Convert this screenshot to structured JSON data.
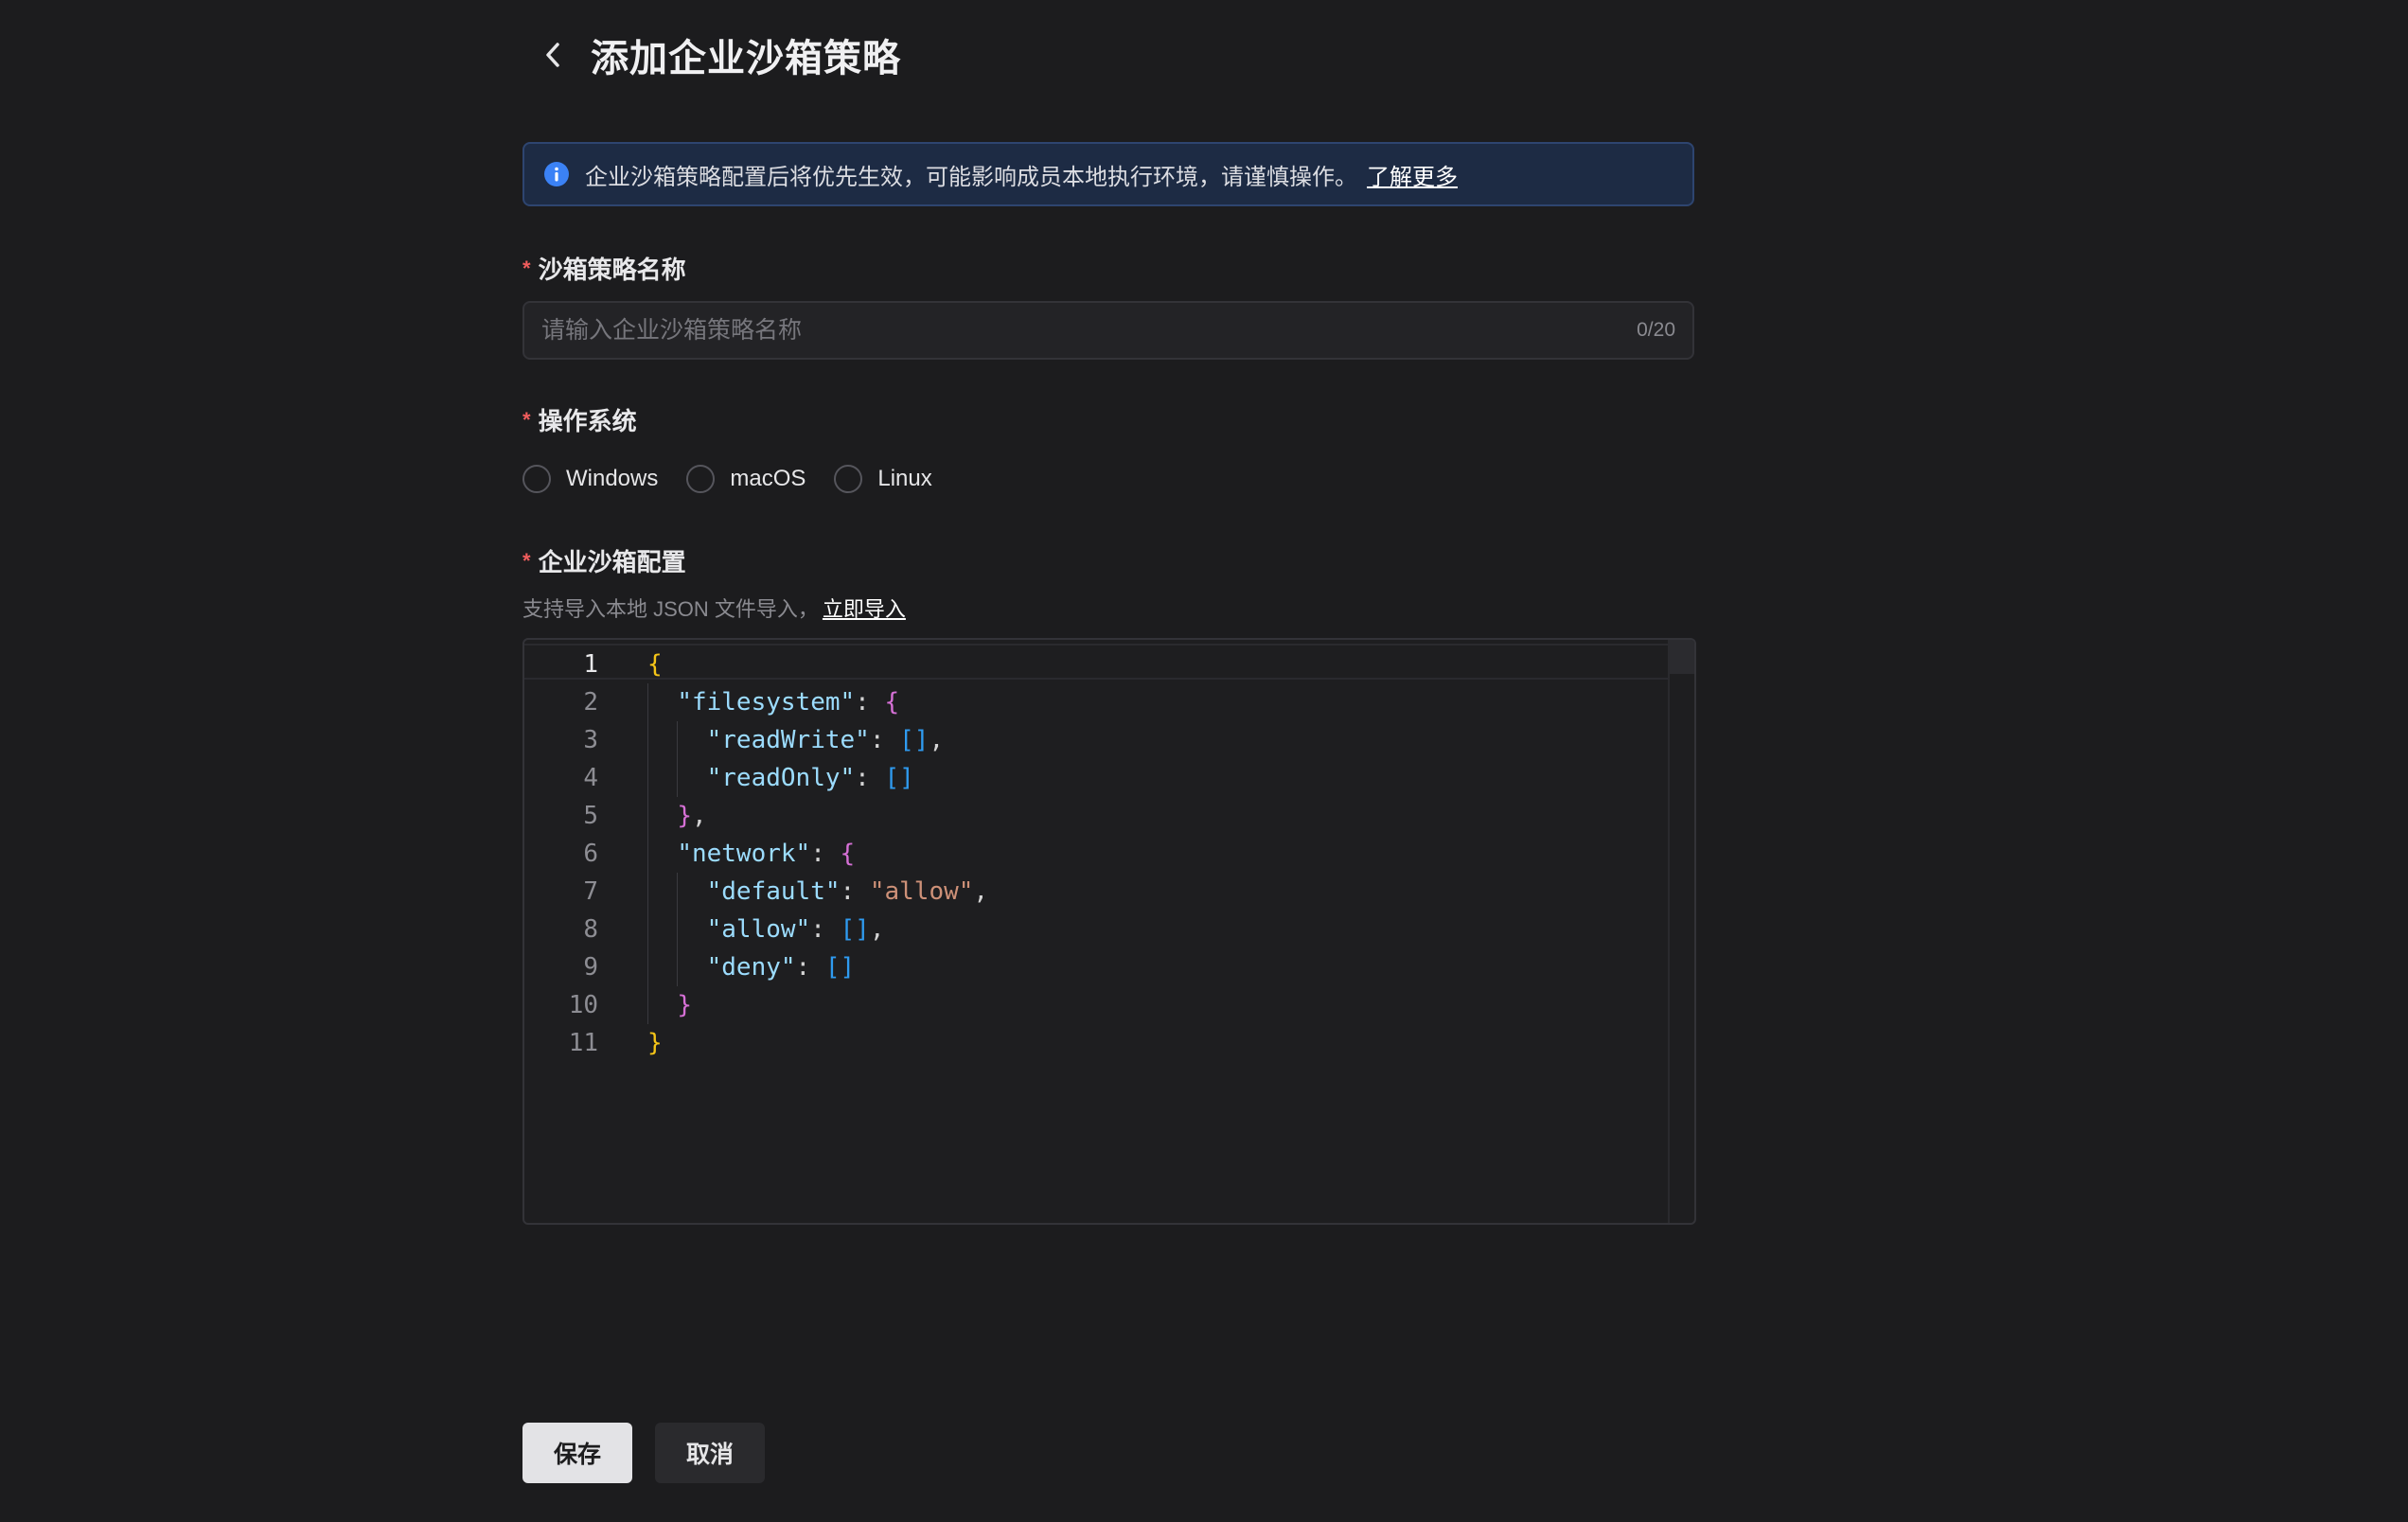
{
  "header": {
    "title": "添加企业沙箱策略"
  },
  "notice": {
    "text": "企业沙箱策略配置后将优先生效，可能影响成员本地执行环境，请谨慎操作。",
    "link": "了解更多"
  },
  "policy_name": {
    "required_mark": "*",
    "label": "沙箱策略名称",
    "placeholder": "请输入企业沙箱策略名称",
    "value": "",
    "counter": "0/20"
  },
  "os": {
    "required_mark": "*",
    "label": "操作系统",
    "options": [
      {
        "label": "Windows",
        "selected": false
      },
      {
        "label": "macOS",
        "selected": false
      },
      {
        "label": "Linux",
        "selected": false
      }
    ]
  },
  "config": {
    "required_mark": "*",
    "label": "企业沙箱配置",
    "hint": "支持导入本地 JSON 文件导入，",
    "hint_link": "立即导入",
    "line_numbers": [
      "1",
      "2",
      "3",
      "4",
      "5",
      "6",
      "7",
      "8",
      "9",
      "10",
      "11"
    ],
    "code": {
      "k_filesystem": "\"filesystem\"",
      "k_readWrite": "\"readWrite\"",
      "k_readOnly": "\"readOnly\"",
      "k_network": "\"network\"",
      "k_default": "\"default\"",
      "v_allow": "\"allow\"",
      "k_allow": "\"allow\"",
      "k_deny": "\"deny\""
    }
  },
  "actions": {
    "save": "保存",
    "cancel": "取消"
  },
  "colors": {
    "background": "#1c1c1e",
    "notice_bg": "#1d2b44",
    "info_icon": "#3b82f6",
    "required": "#f05d5d"
  },
  "icons": {
    "back": "chevron-left-icon",
    "info": "info-circle-icon"
  }
}
